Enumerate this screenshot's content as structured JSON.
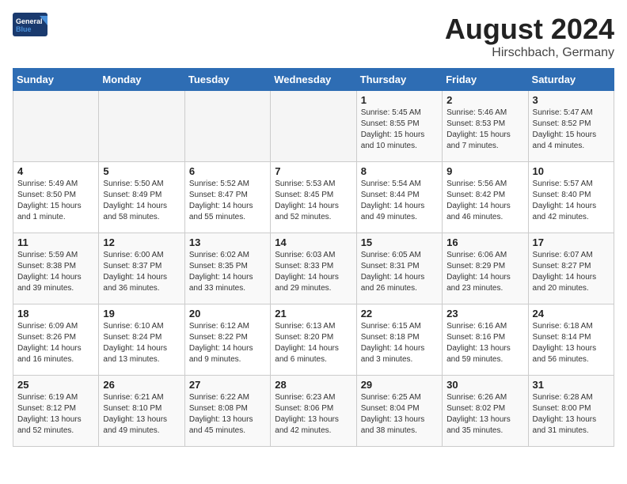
{
  "logo": {
    "line1": "General",
    "line2": "Blue"
  },
  "calendar": {
    "title": "August 2024",
    "subtitle": "Hirschbach, Germany"
  },
  "weekdays": [
    "Sunday",
    "Monday",
    "Tuesday",
    "Wednesday",
    "Thursday",
    "Friday",
    "Saturday"
  ],
  "weeks": [
    [
      {
        "day": "",
        "info": ""
      },
      {
        "day": "",
        "info": ""
      },
      {
        "day": "",
        "info": ""
      },
      {
        "day": "",
        "info": ""
      },
      {
        "day": "1",
        "info": "Sunrise: 5:45 AM\nSunset: 8:55 PM\nDaylight: 15 hours and 10 minutes."
      },
      {
        "day": "2",
        "info": "Sunrise: 5:46 AM\nSunset: 8:53 PM\nDaylight: 15 hours and 7 minutes."
      },
      {
        "day": "3",
        "info": "Sunrise: 5:47 AM\nSunset: 8:52 PM\nDaylight: 15 hours and 4 minutes."
      }
    ],
    [
      {
        "day": "4",
        "info": "Sunrise: 5:49 AM\nSunset: 8:50 PM\nDaylight: 15 hours and 1 minute."
      },
      {
        "day": "5",
        "info": "Sunrise: 5:50 AM\nSunset: 8:49 PM\nDaylight: 14 hours and 58 minutes."
      },
      {
        "day": "6",
        "info": "Sunrise: 5:52 AM\nSunset: 8:47 PM\nDaylight: 14 hours and 55 minutes."
      },
      {
        "day": "7",
        "info": "Sunrise: 5:53 AM\nSunset: 8:45 PM\nDaylight: 14 hours and 52 minutes."
      },
      {
        "day": "8",
        "info": "Sunrise: 5:54 AM\nSunset: 8:44 PM\nDaylight: 14 hours and 49 minutes."
      },
      {
        "day": "9",
        "info": "Sunrise: 5:56 AM\nSunset: 8:42 PM\nDaylight: 14 hours and 46 minutes."
      },
      {
        "day": "10",
        "info": "Sunrise: 5:57 AM\nSunset: 8:40 PM\nDaylight: 14 hours and 42 minutes."
      }
    ],
    [
      {
        "day": "11",
        "info": "Sunrise: 5:59 AM\nSunset: 8:38 PM\nDaylight: 14 hours and 39 minutes."
      },
      {
        "day": "12",
        "info": "Sunrise: 6:00 AM\nSunset: 8:37 PM\nDaylight: 14 hours and 36 minutes."
      },
      {
        "day": "13",
        "info": "Sunrise: 6:02 AM\nSunset: 8:35 PM\nDaylight: 14 hours and 33 minutes."
      },
      {
        "day": "14",
        "info": "Sunrise: 6:03 AM\nSunset: 8:33 PM\nDaylight: 14 hours and 29 minutes."
      },
      {
        "day": "15",
        "info": "Sunrise: 6:05 AM\nSunset: 8:31 PM\nDaylight: 14 hours and 26 minutes."
      },
      {
        "day": "16",
        "info": "Sunrise: 6:06 AM\nSunset: 8:29 PM\nDaylight: 14 hours and 23 minutes."
      },
      {
        "day": "17",
        "info": "Sunrise: 6:07 AM\nSunset: 8:27 PM\nDaylight: 14 hours and 20 minutes."
      }
    ],
    [
      {
        "day": "18",
        "info": "Sunrise: 6:09 AM\nSunset: 8:26 PM\nDaylight: 14 hours and 16 minutes."
      },
      {
        "day": "19",
        "info": "Sunrise: 6:10 AM\nSunset: 8:24 PM\nDaylight: 14 hours and 13 minutes."
      },
      {
        "day": "20",
        "info": "Sunrise: 6:12 AM\nSunset: 8:22 PM\nDaylight: 14 hours and 9 minutes."
      },
      {
        "day": "21",
        "info": "Sunrise: 6:13 AM\nSunset: 8:20 PM\nDaylight: 14 hours and 6 minutes."
      },
      {
        "day": "22",
        "info": "Sunrise: 6:15 AM\nSunset: 8:18 PM\nDaylight: 14 hours and 3 minutes."
      },
      {
        "day": "23",
        "info": "Sunrise: 6:16 AM\nSunset: 8:16 PM\nDaylight: 13 hours and 59 minutes."
      },
      {
        "day": "24",
        "info": "Sunrise: 6:18 AM\nSunset: 8:14 PM\nDaylight: 13 hours and 56 minutes."
      }
    ],
    [
      {
        "day": "25",
        "info": "Sunrise: 6:19 AM\nSunset: 8:12 PM\nDaylight: 13 hours and 52 minutes."
      },
      {
        "day": "26",
        "info": "Sunrise: 6:21 AM\nSunset: 8:10 PM\nDaylight: 13 hours and 49 minutes."
      },
      {
        "day": "27",
        "info": "Sunrise: 6:22 AM\nSunset: 8:08 PM\nDaylight: 13 hours and 45 minutes."
      },
      {
        "day": "28",
        "info": "Sunrise: 6:23 AM\nSunset: 8:06 PM\nDaylight: 13 hours and 42 minutes."
      },
      {
        "day": "29",
        "info": "Sunrise: 6:25 AM\nSunset: 8:04 PM\nDaylight: 13 hours and 38 minutes."
      },
      {
        "day": "30",
        "info": "Sunrise: 6:26 AM\nSunset: 8:02 PM\nDaylight: 13 hours and 35 minutes."
      },
      {
        "day": "31",
        "info": "Sunrise: 6:28 AM\nSunset: 8:00 PM\nDaylight: 13 hours and 31 minutes."
      }
    ]
  ]
}
